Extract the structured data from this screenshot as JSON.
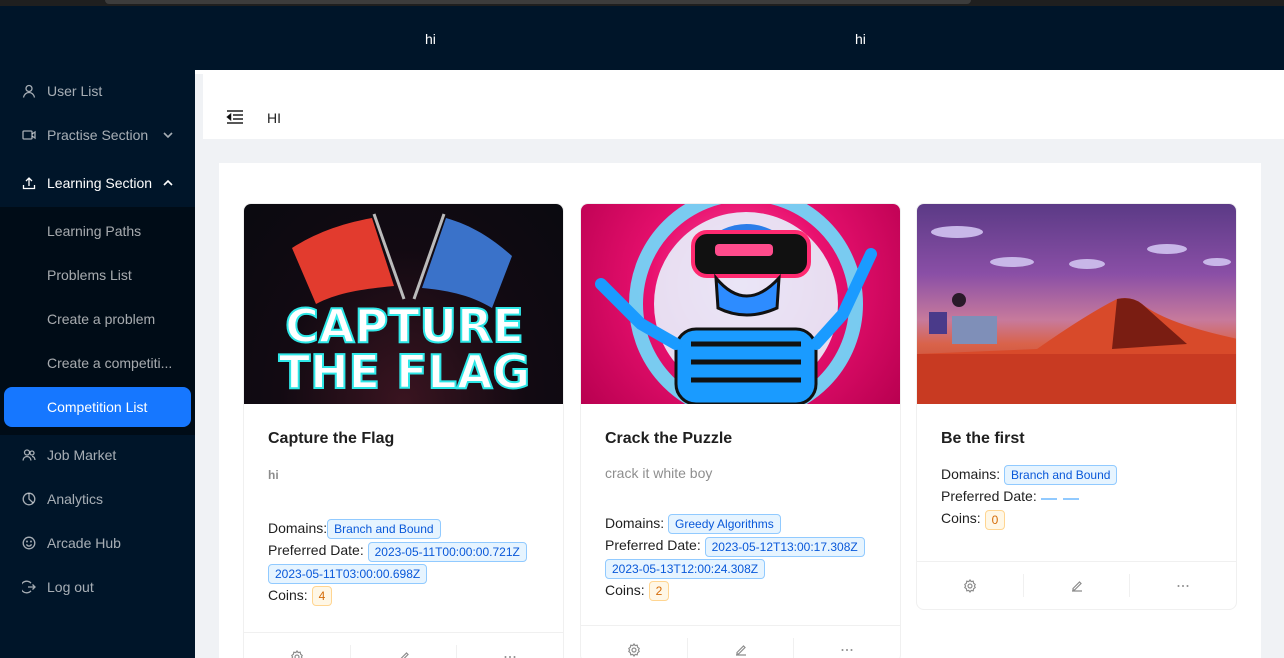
{
  "header": {
    "left_text": "hi",
    "right_text": "hi"
  },
  "sidebar": {
    "items": [
      {
        "label": "User List",
        "icon": "user-icon"
      },
      {
        "label": "Practise Section",
        "icon": "video-camera-icon"
      },
      {
        "label": "Learning Section",
        "icon": "upload-icon"
      },
      {
        "label": "Job Market",
        "icon": "team-icon"
      },
      {
        "label": "Analytics",
        "icon": "pie-chart-icon"
      },
      {
        "label": "Arcade Hub",
        "icon": "smile-icon"
      },
      {
        "label": "Log out",
        "icon": "logout-icon"
      }
    ],
    "sub_items": [
      {
        "label": "Learning Paths"
      },
      {
        "label": "Problems List"
      },
      {
        "label": "Create a problem"
      },
      {
        "label": "Create a competiti..."
      },
      {
        "label": "Competition List",
        "active": true
      }
    ]
  },
  "content_header": {
    "title": "HI"
  },
  "cards": [
    {
      "title": "Capture the Flag",
      "description": "hi",
      "cover_text": [
        "CAPTURE",
        "THE FLAG"
      ],
      "domains_label": "Domains:",
      "domains": [
        "Branch and Bound"
      ],
      "preferred_date_label": "Preferred Date:",
      "dates": [
        "2023-05-11T00:00:00.721Z",
        "2023-05-11T03:00:00.698Z"
      ],
      "coins_label": "Coins:",
      "coins": "4"
    },
    {
      "title": "Crack the Puzzle",
      "description": "crack it white boy",
      "domains_label": "Domains:",
      "domains": [
        "Greedy Algorithms"
      ],
      "preferred_date_label": "Preferred Date:",
      "dates": [
        "2023-05-12T13:00:17.308Z",
        "2023-05-13T12:00:24.308Z"
      ],
      "coins_label": "Coins:",
      "coins": "2"
    },
    {
      "title": "Be the first",
      "description": "",
      "domains_label": "Domains:",
      "domains": [
        "Branch and Bound"
      ],
      "preferred_date_label": "Preferred Date:",
      "dates": [],
      "coins_label": "Coins:",
      "coins": "0"
    }
  ],
  "card_actions": [
    "setting-icon",
    "edit-icon",
    "ellipsis-icon"
  ],
  "colors": {
    "sider": "#001529",
    "active": "#1677ff",
    "tag_blue": "#0958d9",
    "tag_gold": "#d46b08"
  }
}
